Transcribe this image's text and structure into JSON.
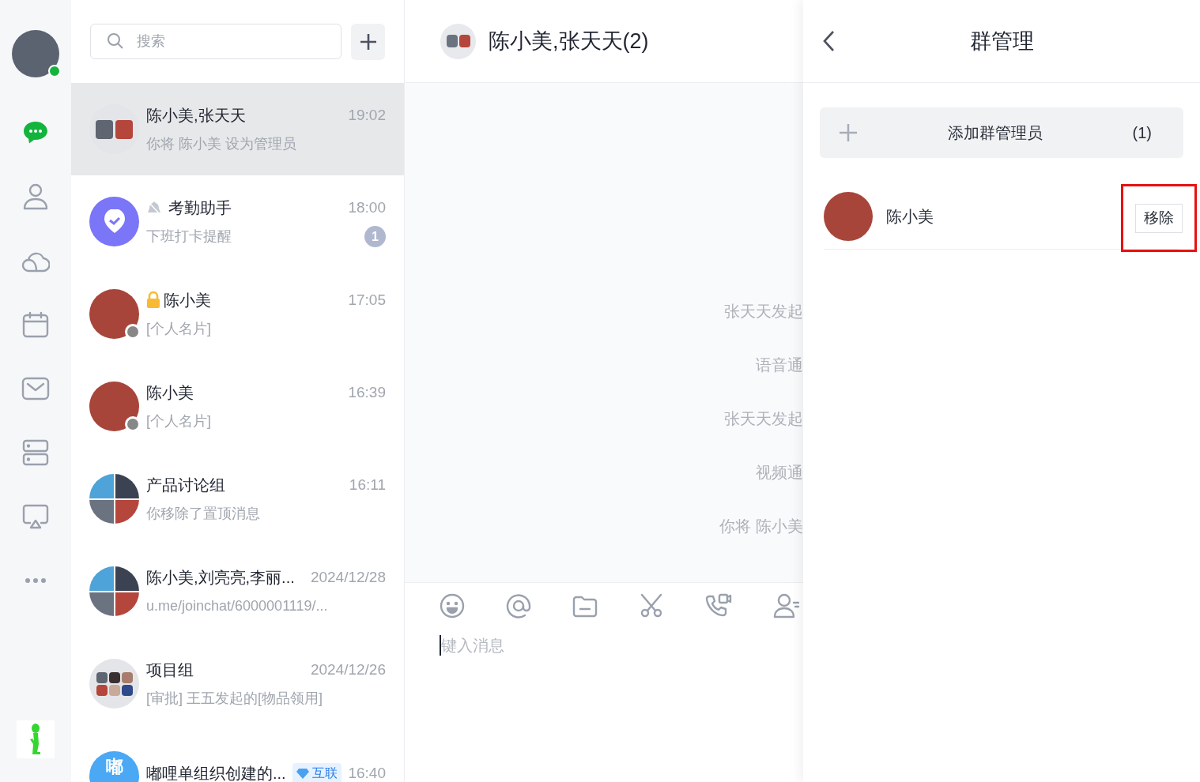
{
  "nav": {
    "online": true,
    "items": [
      {
        "kind": "chat",
        "selected": true
      },
      {
        "kind": "contacts",
        "selected": false
      },
      {
        "kind": "cloud",
        "selected": false
      },
      {
        "kind": "calendar",
        "selected": false
      },
      {
        "kind": "mail",
        "selected": false
      },
      {
        "kind": "server",
        "selected": false
      },
      {
        "kind": "screen",
        "selected": false
      },
      {
        "kind": "more",
        "selected": false
      }
    ]
  },
  "search": {
    "placeholder": "搜索"
  },
  "conversations": [
    {
      "kind": "group2",
      "name": "陈小美,张天天",
      "time": "19:02",
      "preview": "你将 陈小美 设为管理员",
      "selected": true
    },
    {
      "kind": "assistant",
      "name": "考勤助手",
      "muted": true,
      "time": "18:00",
      "preview": "下班打卡提醒",
      "badge": "1",
      "selected": false
    },
    {
      "kind": "person",
      "online": false,
      "locked": true,
      "name": "陈小美",
      "time": "17:05",
      "preview": "[个人名片]",
      "selected": false
    },
    {
      "kind": "person",
      "online": false,
      "name": "陈小美",
      "time": "16:39",
      "preview": "[个人名片]",
      "selected": false
    },
    {
      "kind": "group4",
      "name": "产品讨论组",
      "time": "16:11",
      "preview": "你移除了置顶消息",
      "selected": false
    },
    {
      "kind": "group4",
      "name": "陈小美,刘亮亮,李丽...",
      "time": "2024/12/28",
      "preview": "u.me/joinchat/6000001119/...",
      "selected": false
    },
    {
      "kind": "group6",
      "name": "项目组",
      "time": "2024/12/26",
      "preview": "[审批] 王五发起的[物品领用]",
      "selected": false
    },
    {
      "kind": "letter",
      "letter": "嘟",
      "name": "嘟哩单组织创建的...",
      "tag": "互联",
      "time": "16:40",
      "selected": false
    }
  ],
  "chat": {
    "title": "陈小美,张天天(2)",
    "messages": [
      "张天天发起",
      "语音通",
      "张天天发起",
      "视频通",
      "你将 陈小美"
    ],
    "toolbar": [
      {
        "kind": "emoji"
      },
      {
        "kind": "mention"
      },
      {
        "kind": "folder"
      },
      {
        "kind": "screenshot"
      },
      {
        "kind": "call"
      },
      {
        "kind": "contact"
      }
    ],
    "input": {
      "placeholder": "键入消息"
    }
  },
  "panel": {
    "title": "群管理",
    "add_label": "添加群管理员",
    "add_count": "(1)",
    "admins": [
      {
        "name": "陈小美",
        "action": "移除",
        "highlighted": true
      }
    ]
  }
}
